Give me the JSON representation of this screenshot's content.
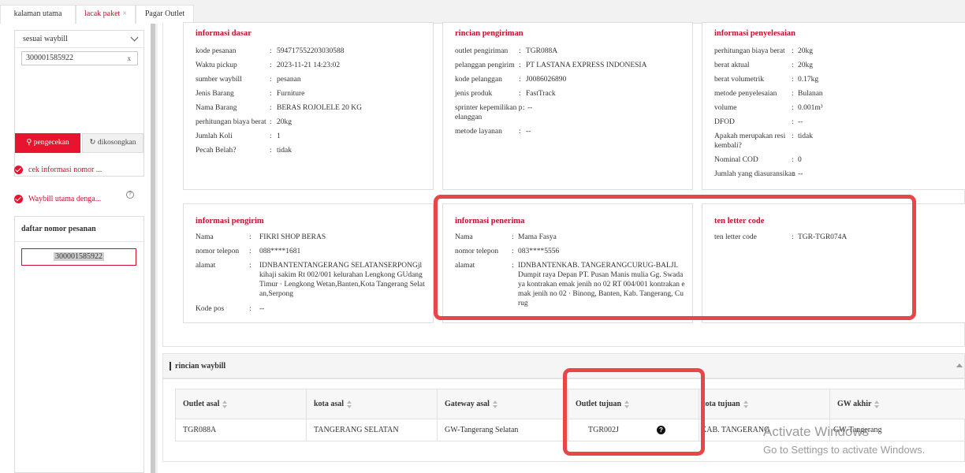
{
  "tabs": [
    {
      "label": "kalaman utama"
    },
    {
      "label": "lacak paket",
      "close": "×"
    },
    {
      "label": "Pagar Outlet"
    }
  ],
  "left": {
    "select_value": "sesuai waybill",
    "waybill_input": "300001585922",
    "clear_x": "x",
    "check_button": "pengecekan",
    "clear_button": "dikosongkan",
    "checks": [
      "cek informasi nomor ...",
      "Waybill utama denga..."
    ],
    "order_list_title": "daftar nomor pesanan",
    "order_item": "300001585922"
  },
  "cards": {
    "dasar": {
      "title": "informasi dasar",
      "rows": [
        {
          "label": "kode pesanan",
          "value": "594717552203030588"
        },
        {
          "label": "Waktu pickup",
          "value": "2023-11-21 14:23:02"
        },
        {
          "label": "sumber waybill",
          "value": "pesanan"
        },
        {
          "label": "Jenis Barang",
          "value": "Furniture"
        },
        {
          "label": "Nama Barang",
          "value": "BERAS ROJOLELE 20 KG"
        },
        {
          "label": "perhitungan biaya berat",
          "value": "20kg"
        },
        {
          "label": "Jumlah Koli",
          "value": "1"
        },
        {
          "label": "Pecah Belah?",
          "value": "tidak"
        }
      ]
    },
    "pengiriman": {
      "title": "rincian pengiriman",
      "rows": [
        {
          "label": "outlet pengiriman",
          "value": "TGR088A"
        },
        {
          "label": "pelanggan pengirim",
          "value": "PT LASTANA EXPRESS INDONESIA"
        },
        {
          "label": "kode pelanggan",
          "value": "J0086026890"
        },
        {
          "label": "jenis produk",
          "value": "FastTrack"
        },
        {
          "label": "sprinter kepemilikan pelanggan",
          "value": "--"
        },
        {
          "label": "metode layanan",
          "value": "--"
        }
      ]
    },
    "penyelesaian": {
      "title": "informasi penyelesaian",
      "rows": [
        {
          "label": "perhitungan biaya berat",
          "value": "20kg"
        },
        {
          "label": "berat aktual",
          "value": "20kg"
        },
        {
          "label": "berat volumetrik",
          "value": "0.17kg"
        },
        {
          "label": "metode penyelesaian",
          "value": "Bulanan"
        },
        {
          "label": "volume",
          "value": "0.001m³"
        },
        {
          "label": "DFOD",
          "value": "--"
        },
        {
          "label": "Apakah merupakan resi kembali?",
          "value": "tidak"
        },
        {
          "label": "Nominal COD",
          "value": "0"
        },
        {
          "label": "Jumlah yang diasuransikan",
          "value": "--"
        }
      ]
    },
    "pengirim": {
      "title": "informasi pengirim",
      "rows": [
        {
          "label": "Nama",
          "value": "FIKRI SHOP BERAS"
        },
        {
          "label": "nomor telepon",
          "value": "088****1681"
        },
        {
          "label": "alamat",
          "value": "IDNBANTENTANGERANG SELATANSERPONGjl kihaji sakim Rt 002/001 kelurahan Lengkong GUdang Timur · Lengkong Wetan,Banten,Kota Tangerang Selatan,Serpong"
        },
        {
          "label": "Kode pos",
          "value": "--"
        }
      ]
    },
    "penerima": {
      "title": "informasi penerima",
      "rows": [
        {
          "label": "Nama",
          "value": "Mama Fasya"
        },
        {
          "label": "nomor telepon",
          "value": "083****5556"
        },
        {
          "label": "alamat",
          "value": "IDNBANTENKAB. TANGERANGCURUG-BALJI. Dumpit raya Depan PT. Pusan Manis mulia Gg. Swadaya kontrakan emak jenih no 02 RT 004/001 kontrakan emak jenih no 02 · Binong, Banten, Kab. Tangerang, Curug"
        }
      ]
    },
    "tenletter": {
      "title": "ten letter code",
      "rows": [
        {
          "label": "ten letter code",
          "value": "TGR-TGR074A"
        }
      ]
    }
  },
  "waybill": {
    "title": "rincian waybill",
    "headers": [
      "Outlet asal",
      "kota asal",
      "Gateway asal",
      "Outlet tujuan",
      "kota tujuan",
      "GW akhir"
    ],
    "row": [
      "TGR088A",
      "TANGERANG SELATAN",
      "GW-Tangerang Selatan",
      "TGR002J",
      "KAB. TANGERANG",
      "GW-Tangerang"
    ],
    "help": "?"
  },
  "watermark": {
    "line1": "Activate Windows",
    "line2": "Go to Settings to activate Windows."
  },
  "colors": {
    "accent": "#c8102e",
    "primary_button": "#e8142f",
    "highlight": "#e8474a"
  }
}
